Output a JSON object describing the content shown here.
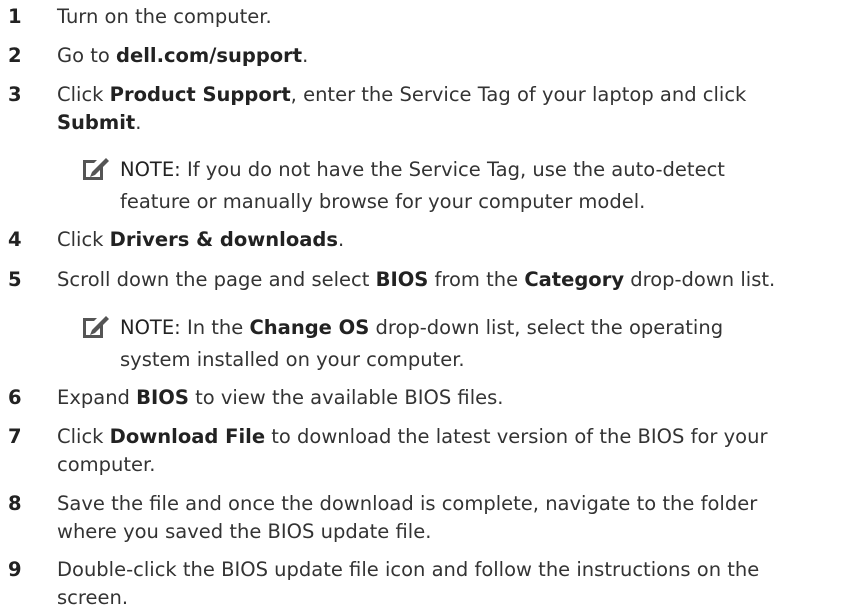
{
  "steps": [
    {
      "number": "1",
      "parts": [
        "Turn on the computer."
      ]
    },
    {
      "number": "2",
      "parts": [
        "Go to ",
        "dell.com/support",
        "."
      ]
    },
    {
      "number": "3",
      "line1": [
        "Click ",
        "Product Support",
        ", enter the Service Tag of your laptop and click"
      ],
      "line2": [
        "Submit",
        "."
      ]
    },
    {
      "number": "4",
      "parts": [
        "Click ",
        "Drivers & downloads",
        "."
      ]
    },
    {
      "number": "5",
      "parts": [
        "Scroll down the page and select ",
        "BIOS",
        " from the ",
        "Category",
        " drop-down list."
      ]
    },
    {
      "number": "6",
      "parts": [
        "Expand ",
        "BIOS",
        " to view the available BIOS files."
      ]
    },
    {
      "number": "7",
      "line1": [
        "Click ",
        "Download File",
        " to download the latest version of the BIOS for your"
      ],
      "line2": [
        "computer."
      ]
    },
    {
      "number": "8",
      "line1": [
        "Save the file and once the download is complete, navigate to the folder"
      ],
      "line2": [
        "where you saved the BIOS update file."
      ]
    },
    {
      "number": "9",
      "line1": [
        "Double-click the BIOS update file icon and follow the instructions on the"
      ],
      "line2": [
        "screen."
      ]
    }
  ],
  "notes": [
    {
      "label": "NOTE:",
      "line1": " If you do not have the Service Tag, use the auto-detect",
      "line2": "feature or manually browse for your computer model."
    },
    {
      "label": "NOTE:",
      "line1_a": " In the ",
      "line1_b": "Change OS",
      "line1_c": " drop-down list, select the operating",
      "line2": "system installed on your computer."
    }
  ],
  "icons": {
    "note": "pencil-note-icon"
  }
}
